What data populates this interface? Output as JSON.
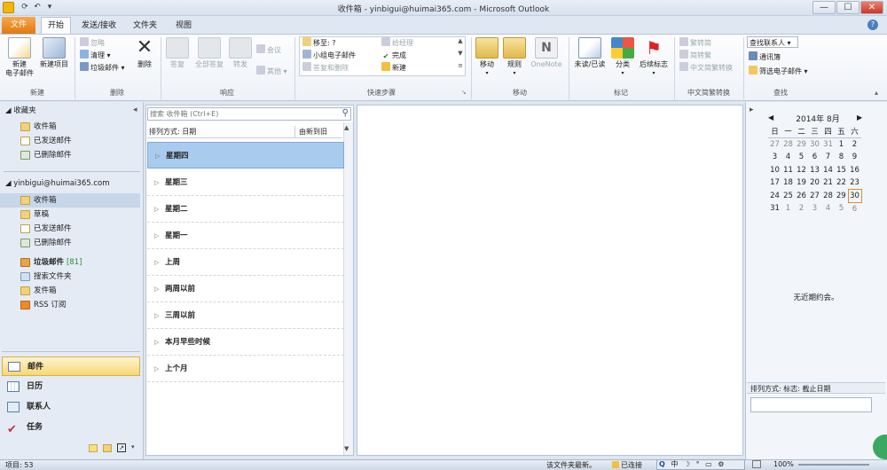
{
  "window": {
    "title": "收件箱 - yinbigui@huimai365.com - Microsoft Outlook",
    "minimize": "—",
    "maximize": "☐",
    "close": "✕"
  },
  "tabs": [
    "文件",
    "开始",
    "发送/接收",
    "文件夹",
    "视图"
  ],
  "ribbon": {
    "new_group": {
      "label": "新建",
      "new_email": "新建\n电子邮件",
      "new_items": "新建项目"
    },
    "delete_group": {
      "label": "删除",
      "ignore": "忽略",
      "cleanup": "清理",
      "junk": "垃圾邮件",
      "delete": "删除"
    },
    "respond_group": {
      "label": "响应",
      "reply": "答复",
      "reply_all": "全部答复",
      "forward": "转发",
      "meeting": "会议",
      "more": "其他"
    },
    "quicksteps_group": {
      "label": "快速步骤",
      "items": [
        "移至: ?",
        "小组电子邮件",
        "答复和删除",
        "给经理",
        "完成",
        "新建"
      ]
    },
    "move_group": {
      "label": "移动",
      "move": "移动",
      "rules": "规则",
      "onenote": "OneNote"
    },
    "tags_group": {
      "label": "标记",
      "unread": "未读/已读",
      "categorize": "分类",
      "followup": "后续标志"
    },
    "chinese_group": {
      "label": "中文简繁转换",
      "t2s": "繁转简",
      "s2t": "简转繁",
      "convert": "中文简繁转换"
    },
    "find_group": {
      "label": "查找",
      "find_contact": "查找联系人",
      "address_book": "通讯簿",
      "filter": "筛选电子邮件"
    }
  },
  "nav": {
    "favorites_header": "收藏夹",
    "favorites": [
      "收件箱",
      "已发送邮件",
      "已删除邮件"
    ],
    "account": "yinbigui@huimai365.com",
    "folders": [
      "收件箱",
      "草稿",
      "已发送邮件",
      "已删除邮件"
    ],
    "junk": "垃圾邮件",
    "junk_count": "[81]",
    "more_folders": [
      "搜索文件夹",
      "发件箱",
      "RSS 订阅"
    ],
    "bottom": [
      "邮件",
      "日历",
      "联系人",
      "任务"
    ]
  },
  "list": {
    "search_placeholder": "搜索 收件箱 (Ctrl+E)",
    "sort_label": "排列方式: 日期",
    "sort_order": "由新到旧",
    "groups": [
      "星期四",
      "星期三",
      "星期二",
      "星期一",
      "上周",
      "两周以前",
      "三周以前",
      "本月早些时候",
      "上个月"
    ]
  },
  "todo": {
    "month": "2014年 8月",
    "weekdays": [
      "日",
      "一",
      "二",
      "三",
      "四",
      "五",
      "六"
    ],
    "weeks": [
      [
        "27",
        "28",
        "29",
        "30",
        "31",
        "1",
        "2"
      ],
      [
        "3",
        "4",
        "5",
        "6",
        "7",
        "8",
        "9"
      ],
      [
        "10",
        "11",
        "12",
        "13",
        "14",
        "15",
        "16"
      ],
      [
        "17",
        "18",
        "19",
        "20",
        "21",
        "22",
        "23"
      ],
      [
        "24",
        "25",
        "26",
        "27",
        "28",
        "29",
        "30"
      ],
      [
        "31",
        "1",
        "2",
        "3",
        "4",
        "5",
        "6"
      ]
    ],
    "no_appointments": "无近期约会。",
    "task_sort": "排列方式: 标志: 截止日期"
  },
  "status": {
    "items": "项目: 53",
    "updating": "该文件夹最新。",
    "connected": "已连接",
    "zoom": "100%"
  },
  "colors": {
    "accent": "#f0a030",
    "selected": "#a9cbee"
  }
}
